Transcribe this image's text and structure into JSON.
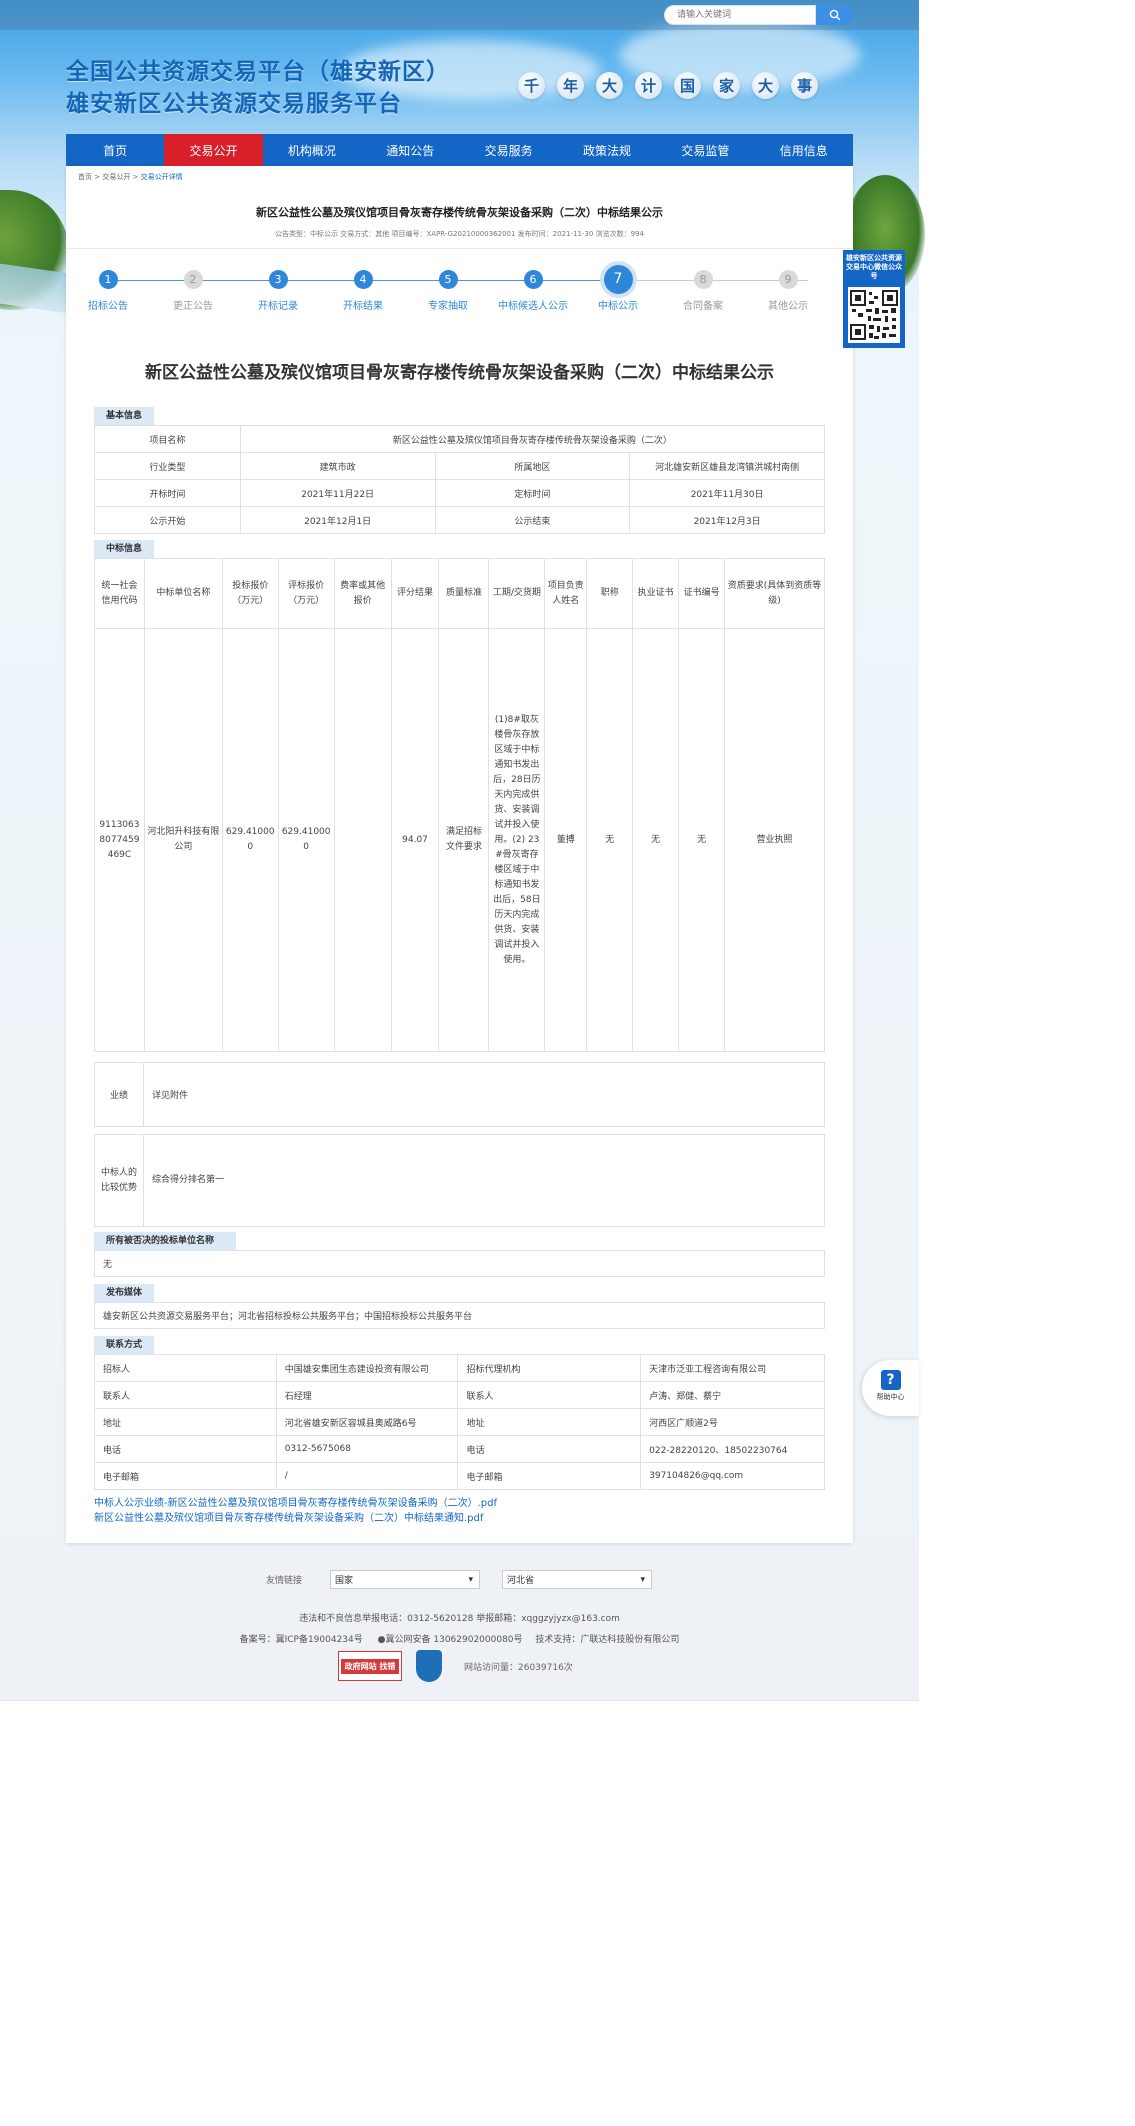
{
  "search": {
    "placeholder": "请输入关键词"
  },
  "logo": {
    "line1": "全国公共资源交易平台（雄安新区）",
    "line2": "雄安新区公共资源交易服务平台"
  },
  "slogan": [
    "千",
    "年",
    "大",
    "计",
    "国",
    "家",
    "大",
    "事"
  ],
  "nav": [
    "首页",
    "交易公开",
    "机构概况",
    "通知公告",
    "交易服务",
    "政策法规",
    "交易监管",
    "信用信息"
  ],
  "breadcrumb": {
    "home": "首页",
    "sep": " > ",
    "level1": "交易公开",
    "current": "交易公开详情"
  },
  "header": {
    "title": "新区公益性公墓及殡仪馆项目骨灰寄存楼传统骨灰架设备采购（二次）中标结果公示",
    "meta": "公告类型：中标公示  交易方式：其他  项目编号：XAPR-G20210000362001  发布时间：2021-11-30  浏览次数：994"
  },
  "steps": [
    {
      "n": "1",
      "label": "招标公告"
    },
    {
      "n": "2",
      "label": "更正公告"
    },
    {
      "n": "3",
      "label": "开标记录"
    },
    {
      "n": "4",
      "label": "开标结果"
    },
    {
      "n": "5",
      "label": "专家抽取"
    },
    {
      "n": "6",
      "label": "中标候选人公示"
    },
    {
      "n": "7",
      "label": "中标公示"
    },
    {
      "n": "8",
      "label": "合同备案"
    },
    {
      "n": "9",
      "label": "其他公示"
    }
  ],
  "main_title": "新区公益性公墓及殡仪馆项目骨灰寄存楼传统骨灰架设备采购（二次）中标结果公示",
  "basic": {
    "tab": "基本信息",
    "project_name_label": "项目名称",
    "project_name": "新区公益性公墓及殡仪馆项目骨灰寄存楼传统骨灰架设备采购（二次）",
    "industry_label": "行业类型",
    "industry": "建筑市政",
    "region_label": "所属地区",
    "region": "河北雄安新区雄县龙湾镇洪城村南侧",
    "open_label": "开标时间",
    "open": "2021年11月22日",
    "decide_label": "定标时间",
    "decide": "2021年11月30日",
    "pub_start_label": "公示开始",
    "pub_start": "2021年12月1日",
    "pub_end_label": "公示结束",
    "pub_end": "2021年12月3日"
  },
  "winner": {
    "tab": "中标信息",
    "headers": [
      "统一社会信用代码",
      "中标单位名称",
      "投标报价（万元）",
      "评标报价（万元）",
      "费率或其他报价",
      "评分结果",
      "质量标准",
      "工期/交货期",
      "项目负责人姓名",
      "职称",
      "执业证书",
      "证书编号",
      "资质要求(具体到资质等级)"
    ],
    "credit_code": "91130638077459469C",
    "company": "河北阳升科技有限公司",
    "bid_price": "629.410000",
    "eval_price": "629.410000",
    "rate": "",
    "score": "94.07",
    "quality": "满足招标文件要求",
    "period": "(1)8#取灰楼骨灰存放区域于中标通知书发出后，28日历天内完成供货、安装调试并投入使用。(2) 23#骨灰寄存楼区域于中标通知书发出后，58日历天内完成供货、安装调试并投入使用。",
    "manager": "董搏",
    "title": "无",
    "cert": "无",
    "cert_no": "无",
    "qualification": "营业执照"
  },
  "performance": {
    "label": "业绩",
    "value": "详见附件"
  },
  "advantage": {
    "label": "中标人的比较优势",
    "value": "综合得分排名第一"
  },
  "rejected": {
    "tab": "所有被否决的投标单位名称",
    "value": "无"
  },
  "media": {
    "tab": "发布媒体",
    "value": "雄安新区公共资源交易服务平台；河北省招标投标公共服务平台；中国招标投标公共服务平台"
  },
  "contact": {
    "tab": "联系方式",
    "rows": [
      [
        "招标人",
        "中国雄安集团生态建设投资有限公司",
        "招标代理机构",
        "天津市泛亚工程咨询有限公司"
      ],
      [
        "联系人",
        "石经理",
        "联系人",
        "卢涛、郑健、蔡宁"
      ],
      [
        "地址",
        "河北省雄安新区容城县奥威路6号",
        "地址",
        "河西区广顺道2号"
      ],
      [
        "电话",
        "0312-5675068",
        "电话",
        "022-28220120、18502230764"
      ],
      [
        "电子邮箱",
        "/",
        "电子邮箱",
        "397104826@qq.com"
      ]
    ]
  },
  "attachments": [
    "中标人公示业绩-新区公益性公墓及殡仪馆项目骨灰寄存楼传统骨灰架设备采购（二次）.pdf",
    "新区公益性公墓及殡仪馆项目骨灰寄存楼传统骨灰架设备采购（二次）中标结果通知.pdf"
  ],
  "qr": {
    "text": "雄安新区公共资源交易中心微信公众号"
  },
  "help": {
    "label": "帮助中心"
  },
  "footer": {
    "links_label": "友情链接",
    "select1": "国家",
    "select2": "河北省",
    "line1": "违法和不良信息举报电话：0312-5620128    举报邮箱：xqggzyjyzx@163.com",
    "line2_a": "备案号：冀ICP备19004234号",
    "line2_b": "冀公网安备 13062902000080号",
    "line2_c": "技术支持：广联达科技股份有限公司",
    "gov_badge": "政府网站 找错",
    "visits": "网站访问量：26039716次"
  }
}
